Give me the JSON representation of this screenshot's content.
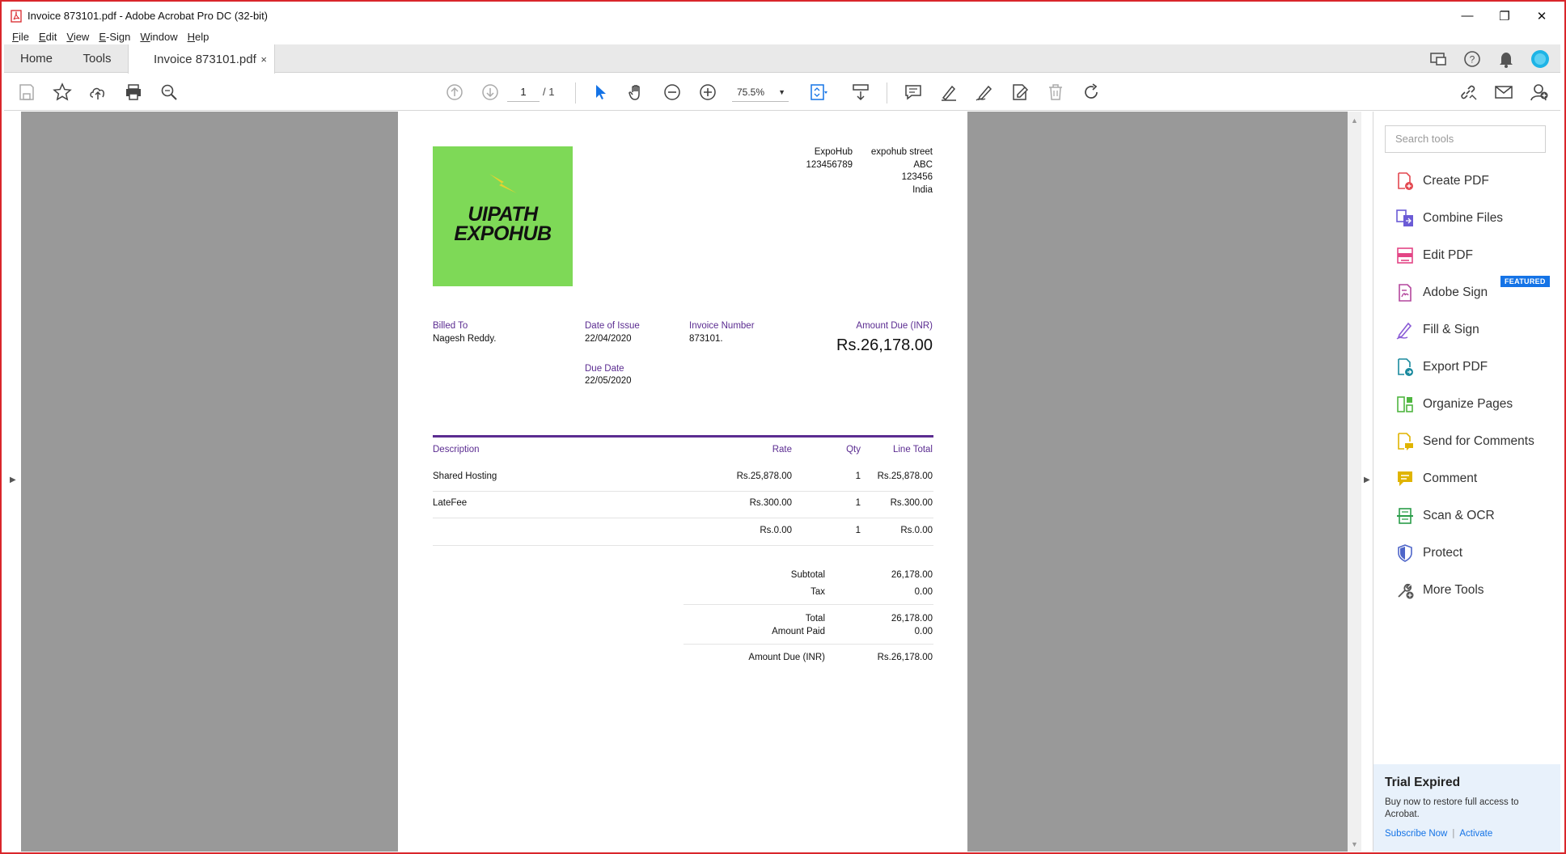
{
  "window": {
    "title": "Invoice 873101.pdf - Adobe Acrobat Pro DC (32-bit)",
    "controls": {
      "minimize": "—",
      "restore": "❐",
      "close": "✕"
    }
  },
  "menu": [
    "File",
    "Edit",
    "View",
    "E-Sign",
    "Window",
    "Help"
  ],
  "tabs": {
    "home": "Home",
    "tools": "Tools",
    "document": "Invoice 873101.pdf",
    "close": "×"
  },
  "toolbar": {
    "page_current": "1",
    "page_total": "/ 1",
    "zoom": "75.5%"
  },
  "invoice": {
    "logo": {
      "line1": "UIPATH",
      "line2": "EXPOHUB"
    },
    "company": {
      "name": "ExpoHub",
      "phone": "123456789"
    },
    "address": {
      "street": "expohub street",
      "city": "ABC",
      "zip": "123456",
      "country": "India"
    },
    "billed_to_label": "Billed To",
    "billed_to": "Nagesh Reddy.",
    "date_of_issue_label": "Date of Issue",
    "date_of_issue": "22/04/2020",
    "due_date_label": "Due Date",
    "due_date": "22/05/2020",
    "invoice_number_label": "Invoice Number",
    "invoice_number": "873101.",
    "amount_due_label": "Amount Due (INR)",
    "amount_due": "Rs.26,178.00",
    "table": {
      "headers": {
        "description": "Description",
        "rate": "Rate",
        "qty": "Qty",
        "line_total": "Line Total"
      },
      "rows": [
        {
          "description": "Shared Hosting",
          "rate": "Rs.25,878.00",
          "qty": "1",
          "line_total": "Rs.25,878.00"
        },
        {
          "description": "LateFee",
          "rate": "Rs.300.00",
          "qty": "1",
          "line_total": "Rs.300.00"
        },
        {
          "description": "",
          "rate": "Rs.0.00",
          "qty": "1",
          "line_total": "Rs.0.00"
        }
      ]
    },
    "summary": {
      "subtotal_label": "Subtotal",
      "subtotal": "26,178.00",
      "tax_label": "Tax",
      "tax": "0.00",
      "total_label": "Total",
      "total": "26,178.00",
      "amount_paid_label": "Amount Paid",
      "amount_paid": "0.00",
      "amount_due_label": "Amount Due (INR)",
      "amount_due": "Rs.26,178.00"
    }
  },
  "right_panel": {
    "search_placeholder": "Search tools",
    "tools": [
      {
        "label": "Create PDF",
        "icon": "create-pdf-icon",
        "color": "#e34850"
      },
      {
        "label": "Combine Files",
        "icon": "combine-files-icon",
        "color": "#6b5bd6"
      },
      {
        "label": "Edit PDF",
        "icon": "edit-pdf-icon",
        "color": "#e34585"
      },
      {
        "label": "Adobe Sign",
        "icon": "adobe-sign-icon",
        "color": "#b4479d"
      },
      {
        "label": "Fill & Sign",
        "icon": "fill-sign-icon",
        "color": "#8a5bd6"
      },
      {
        "label": "Export PDF",
        "icon": "export-pdf-icon",
        "color": "#1a8a9e"
      },
      {
        "label": "Organize Pages",
        "icon": "organize-pages-icon",
        "color": "#4fb640"
      },
      {
        "label": "Send for Comments",
        "icon": "send-for-comments-icon",
        "color": "#e0b400"
      },
      {
        "label": "Comment",
        "icon": "comment-icon",
        "color": "#e0b400"
      },
      {
        "label": "Scan & OCR",
        "icon": "scan-ocr-icon",
        "color": "#2a9d49"
      },
      {
        "label": "Protect",
        "icon": "protect-icon",
        "color": "#4f66c9"
      },
      {
        "label": "More Tools",
        "icon": "more-tools-icon",
        "color": "#555555"
      }
    ],
    "featured_badge": "FEATURED",
    "trial": {
      "title": "Trial Expired",
      "message": "Buy now to restore full access to Acrobat.",
      "subscribe": "Subscribe Now",
      "activate": "Activate",
      "separator": "|"
    }
  }
}
